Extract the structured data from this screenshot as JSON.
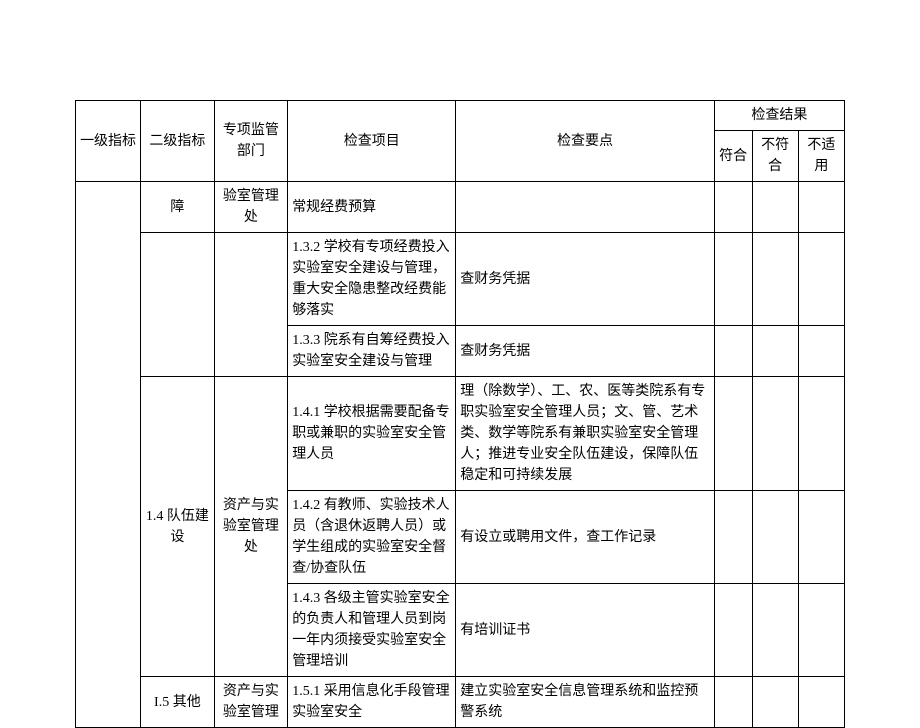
{
  "headers": {
    "c1": "一级指标",
    "c2": "二级指标",
    "c3": "专项监管部门",
    "c4": "检查项目",
    "c5": "检查要点",
    "cg": "检查结果",
    "c6": "符合",
    "c7": "不符合",
    "c8": "不适用"
  },
  "rows": [
    {
      "l2": "障",
      "dept": "验室管理处",
      "item": "常规经费预算",
      "point": ""
    },
    {
      "item": "1.3.2 学校有专项经费投入实验室安全建设与管理，重大安全隐患整改经费能够落实",
      "point": "查财务凭据"
    },
    {
      "item": "1.3.3 院系有自筹经费投入实验室安全建设与管理",
      "point": "查财务凭据"
    },
    {
      "l2": "1.4 队伍建设",
      "dept": "资产与实验室管理处",
      "item": "1.4.1 学校根据需要配备专职或兼职的实验室安全管理人员",
      "point": "理（除数学）、工、农、医等类院系有专职实验室安全管理人员；文、管、艺术类、数学等院系有兼职实验室安全管理人；推进专业安全队伍建设，保障队伍稳定和可持续发展"
    },
    {
      "item": "1.4.2 有教师、实验技术人员（含退休返聘人员）或学生组成的实验室安全督查/协查队伍",
      "point": "有设立或聘用文件，查工作记录"
    },
    {
      "item": "1.4.3 各级主管实验室安全的负责人和管理人员到岗一年内须接受实验室安全管理培训",
      "point": "有培训证书"
    },
    {
      "l2": "I.5 其他",
      "dept": "资产与实验室管理",
      "item": "1.5.1 采用信息化手段管理实验室安全",
      "point": "建立实验室安全信息管理系统和监控预警系统"
    }
  ]
}
